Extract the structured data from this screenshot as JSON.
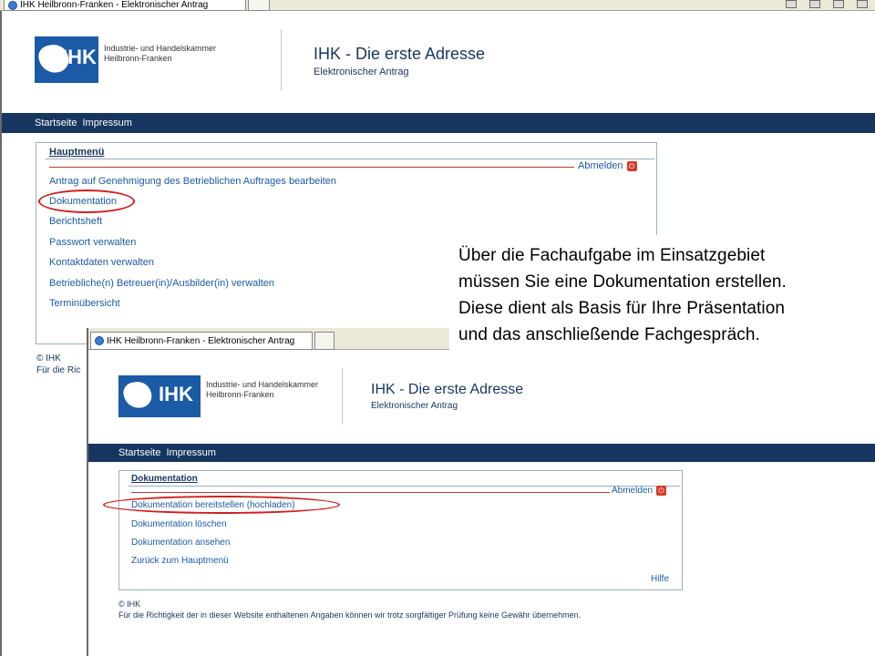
{
  "browser": {
    "tab_title": "IHK Heilbronn-Franken - Elektronischer Antrag"
  },
  "site": {
    "org_name_line1": "Industrie- und Handelskammer",
    "org_name_line2": "Heilbronn-Franken",
    "logo_abbr": "IHK",
    "title": "IHK - Die erste Adresse",
    "subtitle": "Elektronischer Antrag",
    "nav": [
      "Startseite",
      "Impressum"
    ]
  },
  "main_menu": {
    "heading": "Hauptmenü",
    "logout_label": "Abmelden",
    "items": [
      "Antrag auf Genehmigung des Betrieblichen Auftrages bearbeiten",
      "Dokumentation",
      "Berichtsheft",
      "Passwort verwalten",
      "Kontaktdaten verwalten",
      "Betriebliche(n) Betreuer(in)/Ausbilder(in) verwalten",
      "Terminübersicht"
    ]
  },
  "footer1": {
    "copyright": "© IHK",
    "disclaimer_partial": "Für die Ric"
  },
  "doc_menu": {
    "heading": "Dokumentation",
    "logout_label": "Abmelden",
    "items": [
      "Dokumentation bereitstellen (hochladen)",
      "Dokumentation löschen",
      "Dokumentation ansehen",
      "Zurück zum Hauptmenü"
    ],
    "help_label": "Hilfe"
  },
  "footer2": {
    "copyright": "© IHK",
    "disclaimer": "Für die Richtigkeit der in dieser Website enthaltenen Angaben können wir trotz sorgfältiger Prüfung keine Gewähr übernehmen."
  },
  "callout": {
    "lines": [
      "Über die Fachaufgabe im Einsatzgebiet",
      "müssen Sie eine Dokumentation erstellen.",
      "Diese dient als Basis für Ihre Präsentation",
      "und das anschließende Fachgespräch."
    ]
  },
  "colors": {
    "brand_blue": "#1b5aa5",
    "nav_navy": "#16365f",
    "highlight_red": "#d21f1f"
  }
}
